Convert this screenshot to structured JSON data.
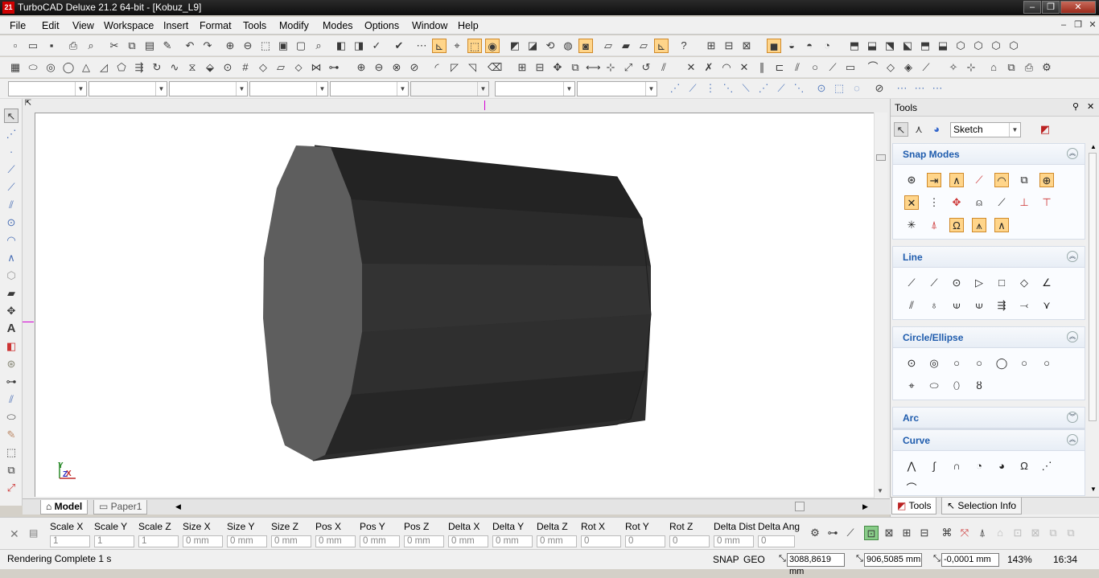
{
  "window": {
    "title": "TurboCAD Deluxe 21.2 64-bit - [Kobuz_L9]",
    "app_icon": "21"
  },
  "menu": [
    "File",
    "Edit",
    "View",
    "Workspace",
    "Insert",
    "Format",
    "Tools",
    "Modify",
    "Modes",
    "Options",
    "Window",
    "Help"
  ],
  "tools_panel": {
    "title": "Tools",
    "mode_select": "Sketch",
    "sections": [
      {
        "label": "Snap Modes",
        "state": "expanded"
      },
      {
        "label": "Line",
        "state": "expanded"
      },
      {
        "label": "Circle/Ellipse",
        "state": "expanded"
      },
      {
        "label": "Arc",
        "state": "collapsed"
      },
      {
        "label": "Curve",
        "state": "expanded"
      }
    ],
    "bottom_tabs": [
      "Tools",
      "Selection Info"
    ]
  },
  "canvas_tabs": [
    "Model",
    "Paper1"
  ],
  "axis_labels": {
    "y": "Y",
    "z": "Z",
    "x": "X"
  },
  "inspector": {
    "fields": [
      {
        "label": "Scale X",
        "value": "1"
      },
      {
        "label": "Scale Y",
        "value": "1"
      },
      {
        "label": "Scale Z",
        "value": "1"
      },
      {
        "label": "Size X",
        "value": "0 mm"
      },
      {
        "label": "Size Y",
        "value": "0 mm"
      },
      {
        "label": "Size Z",
        "value": "0 mm"
      },
      {
        "label": "Pos X",
        "value": "0 mm"
      },
      {
        "label": "Pos Y",
        "value": "0 mm"
      },
      {
        "label": "Pos Z",
        "value": "0 mm"
      },
      {
        "label": "Delta X",
        "value": "0 mm"
      },
      {
        "label": "Delta Y",
        "value": "0 mm"
      },
      {
        "label": "Delta Z",
        "value": "0 mm"
      },
      {
        "label": "Rot X",
        "value": "0"
      },
      {
        "label": "Rot Y",
        "value": "0"
      },
      {
        "label": "Rot Z",
        "value": "0"
      },
      {
        "label": "Delta Dist",
        "value": "0 mm"
      },
      {
        "label": "Delta Ang",
        "value": "0"
      }
    ]
  },
  "status": {
    "message": "Rendering Complete 1 s",
    "snap": "SNAP",
    "geo": "GEO",
    "coord_x": "3088,8619 mm",
    "coord_y": "906,5085 mm",
    "coord_z": "-0,0001 mm",
    "zoom": "143%",
    "time": "16:34"
  },
  "colors": {
    "accent_orange": "#ffd58a",
    "section_title": "#1f5cad",
    "title_bar": "#1a1a1a"
  }
}
